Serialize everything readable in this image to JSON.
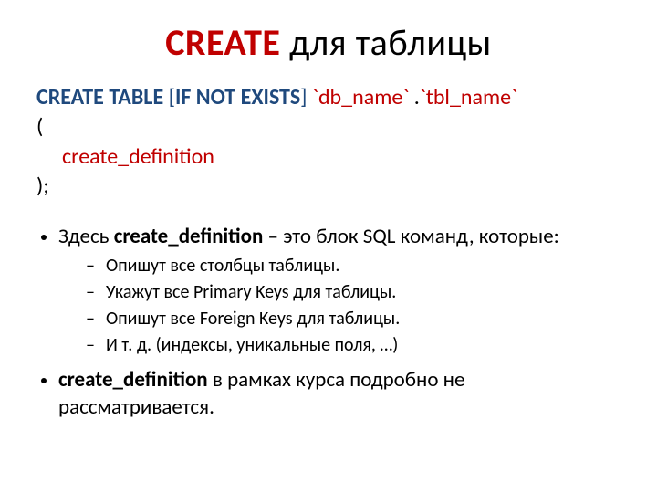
{
  "title": {
    "red": "CREATE",
    "rest": " для таблицы"
  },
  "code": {
    "l1": {
      "a": "CREATE TABLE ",
      "b": "[",
      "c": "IF NOT EXISTS",
      "d": "] ",
      "e": "`db_name`",
      "f": " .",
      "g": "`tbl_name`"
    },
    "l2": "(",
    "l3": "create_definition",
    "l4": ");"
  },
  "bullets": {
    "b1": {
      "pre": "Здесь ",
      "bold": "create_definition",
      "post": " – это блок SQL команд, которые:"
    },
    "sub": [
      "Опишут все столбцы таблицы.",
      "Укажут все Primary Keys для таблицы.",
      "Опишут все Foreign Keys для таблицы.",
      "И т. д. (индексы, уникальные поля, …)"
    ],
    "b2": {
      "bold": "create_definition",
      "post": " в рамках курса подробно не рассматривается."
    }
  }
}
